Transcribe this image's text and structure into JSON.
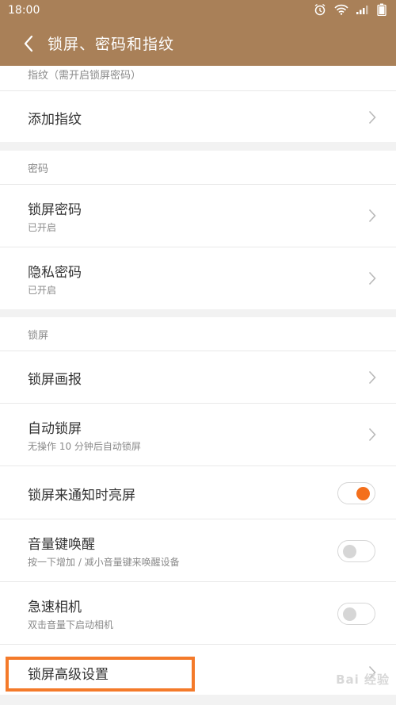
{
  "status_bar": {
    "time": "18:00",
    "icons": [
      "alarm-icon",
      "wifi-icon",
      "signal-icon",
      "battery-icon"
    ]
  },
  "header": {
    "title": "锁屏、密码和指纹",
    "back_icon": "chevron-left-icon"
  },
  "fingerprint": {
    "label": "指纹（需开启锁屏密码）",
    "add": "添加指纹"
  },
  "password": {
    "label": "密码",
    "lock_password": {
      "title": "锁屏密码",
      "sub": "已开启"
    },
    "privacy_password": {
      "title": "隐私密码",
      "sub": "已开启"
    }
  },
  "lockscreen": {
    "label": "锁屏",
    "wallpaper": {
      "title": "锁屏画报"
    },
    "auto_lock": {
      "title": "自动锁屏",
      "sub": "无操作 10 分钟后自动锁屏"
    },
    "wake_on_notify": {
      "title": "锁屏来通知时亮屏",
      "on": true
    },
    "volume_wake": {
      "title": "音量键唤醒",
      "sub": "按一下增加 / 减小音量键来唤醒设备",
      "on": false
    },
    "quick_camera": {
      "title": "急速相机",
      "sub": "双击音量下启动相机",
      "on": false
    },
    "advanced": {
      "title": "锁屏高级设置"
    }
  },
  "watermark": "Bai 经验",
  "colors": {
    "header_bg": "#a98058",
    "toggle_on": "#f46f1c",
    "highlight_border": "#f47a2a"
  }
}
